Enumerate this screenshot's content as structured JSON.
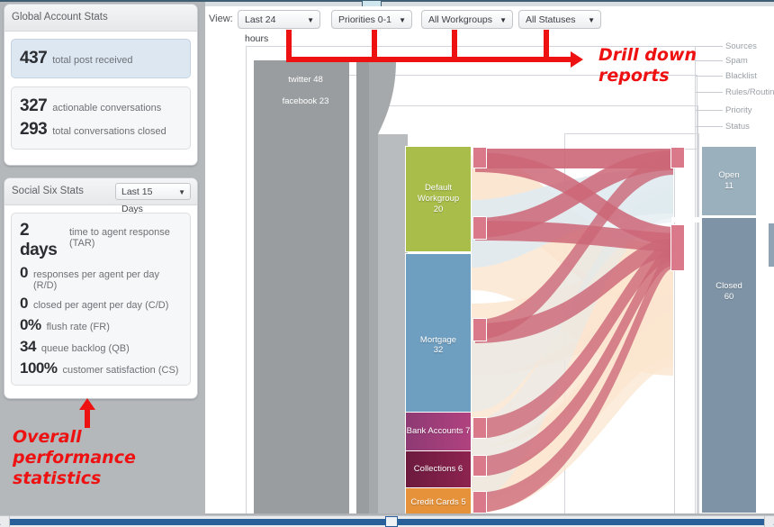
{
  "sidebar": {
    "global_panel": {
      "title": "Global Account Stats",
      "primary": {
        "value": "437",
        "label": "total post received"
      },
      "secondary": [
        {
          "value": "327",
          "label": "actionable conversations"
        },
        {
          "value": "293",
          "label": "total conversations closed"
        }
      ]
    },
    "social_panel": {
      "title": "Social Six Stats",
      "range_select": {
        "value": "Last 15 Days",
        "caret": "chevron-down-icon"
      },
      "metrics": [
        {
          "value": "2 days",
          "label": "time to agent response (TAR)"
        },
        {
          "value": "0",
          "label": "responses per agent per day (R/D)"
        },
        {
          "value": "0",
          "label": "closed per agent per day (C/D)"
        },
        {
          "value": "0%",
          "label": "flush rate (FR)"
        },
        {
          "value": "34",
          "label": "queue backlog (QB)"
        },
        {
          "value": "100%",
          "label": "customer satisfaction (CS)"
        }
      ]
    }
  },
  "annotations": {
    "left": "Overall performance statistics",
    "right": "Drill down reports",
    "color": "#ee1111"
  },
  "toolbar": {
    "view_label": "View:",
    "filters": [
      {
        "name": "time-range",
        "value": "Last 24 hours",
        "caret": "chevron-down-icon"
      },
      {
        "name": "priority",
        "value": "Priorities 0-1",
        "caret": "chevron-down-icon"
      },
      {
        "name": "workgroup",
        "value": "All Workgroups",
        "caret": "chevron-down-icon"
      },
      {
        "name": "status",
        "value": "All Statuses",
        "caret": "chevron-down-icon"
      }
    ]
  },
  "chart_data": {
    "type": "sankey",
    "title": "",
    "stage_labels": [
      "Sources",
      "Spam",
      "Blacklist",
      "Rules/Routing",
      "Priority",
      "Status"
    ],
    "nodes": [
      {
        "id": "twitter",
        "stage": "Sources",
        "label": "twitter 48",
        "value": 48,
        "color": "#9a9d9f"
      },
      {
        "id": "facebook",
        "stage": "Sources",
        "label": "facebook 23",
        "value": 23,
        "color": "#9a9d9f"
      },
      {
        "id": "default",
        "stage": "Rules/Routing",
        "label": "Default Workgroup",
        "value": 20,
        "color": "#a8bd4a"
      },
      {
        "id": "mortgage",
        "stage": "Rules/Routing",
        "label": "Mortgage",
        "value": 32,
        "color": "#6e9ec0"
      },
      {
        "id": "bank",
        "stage": "Rules/Routing",
        "label": "Bank Accounts 7",
        "value": 7,
        "color": "#a33f7e"
      },
      {
        "id": "collect",
        "stage": "Rules/Routing",
        "label": "Collections 6",
        "value": 6,
        "color": "#7c1f45"
      },
      {
        "id": "credit",
        "stage": "Rules/Routing",
        "label": "Credit Cards 5",
        "value": 5,
        "color": "#e5923a"
      },
      {
        "id": "open",
        "stage": "Status",
        "label": "Open",
        "value": 11,
        "color": "#9bb0bd"
      },
      {
        "id": "closed",
        "stage": "Status",
        "label": "Closed",
        "value": 60,
        "color": "#7e94a6"
      }
    ],
    "node_value_text": {
      "default": "20",
      "mortgage": "32",
      "open": "11",
      "closed": "60"
    },
    "links": [
      {
        "source": "twitter",
        "target": "default",
        "value": 20
      },
      {
        "source": "twitter",
        "target": "mortgage",
        "value": 18
      },
      {
        "source": "facebook",
        "target": "mortgage",
        "value": 14
      },
      {
        "source": "facebook",
        "target": "bank",
        "value": 7
      },
      {
        "source": "facebook",
        "target": "collect",
        "value": 6
      },
      {
        "source": "twitter",
        "target": "credit",
        "value": 5
      },
      {
        "source": "default",
        "target": "open",
        "value": 3
      },
      {
        "source": "default",
        "target": "closed",
        "value": 17
      },
      {
        "source": "mortgage",
        "target": "open",
        "value": 5
      },
      {
        "source": "mortgage",
        "target": "closed",
        "value": 27
      },
      {
        "source": "bank",
        "target": "closed",
        "value": 7
      },
      {
        "source": "collect",
        "target": "closed",
        "value": 6
      },
      {
        "source": "credit",
        "target": "open",
        "value": 3
      },
      {
        "source": "credit",
        "target": "closed",
        "value": 3
      }
    ],
    "link_colors": {
      "highlight": "#cc6677",
      "pale_orange": "#fbe5cf",
      "pale_blue": "#dfeaf0"
    },
    "legend_position": "right"
  }
}
